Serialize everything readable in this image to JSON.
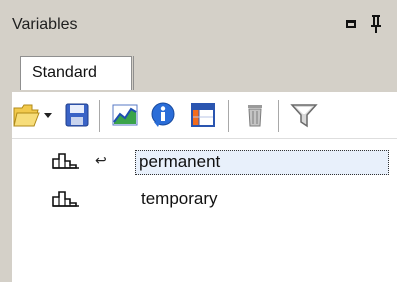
{
  "panel": {
    "title": "Variables",
    "maximize_icon": "maximize-icon",
    "pin_icon": "pin-icon"
  },
  "tabs": [
    {
      "label": "Standard",
      "active": true
    }
  ],
  "toolbar": {
    "items": [
      {
        "name": "open-folder",
        "icon": "folder-icon",
        "has_dropdown": true
      },
      {
        "name": "save",
        "icon": "floppy-disk-icon"
      },
      {
        "name": "graph",
        "icon": "graph-icon"
      },
      {
        "name": "info",
        "icon": "info-icon"
      },
      {
        "name": "table",
        "icon": "table-icon"
      },
      {
        "name": "delete",
        "icon": "trash-icon"
      },
      {
        "name": "filter",
        "icon": "filter-icon"
      }
    ]
  },
  "variables": [
    {
      "name": "permanent",
      "icon": "histogram-icon",
      "flag": "↩",
      "selected": true
    },
    {
      "name": "temporary",
      "icon": "histogram-icon",
      "flag": "",
      "selected": false
    }
  ],
  "colors": {
    "panel_bg": "#d4d0c8",
    "selection_bg": "#e8f0fb",
    "folder_yellow": "#f2c94c",
    "save_blue": "#3a63c6",
    "graph_green": "#3aa34a",
    "info_blue": "#2a6dd8",
    "table_orange": "#f26b1d"
  }
}
